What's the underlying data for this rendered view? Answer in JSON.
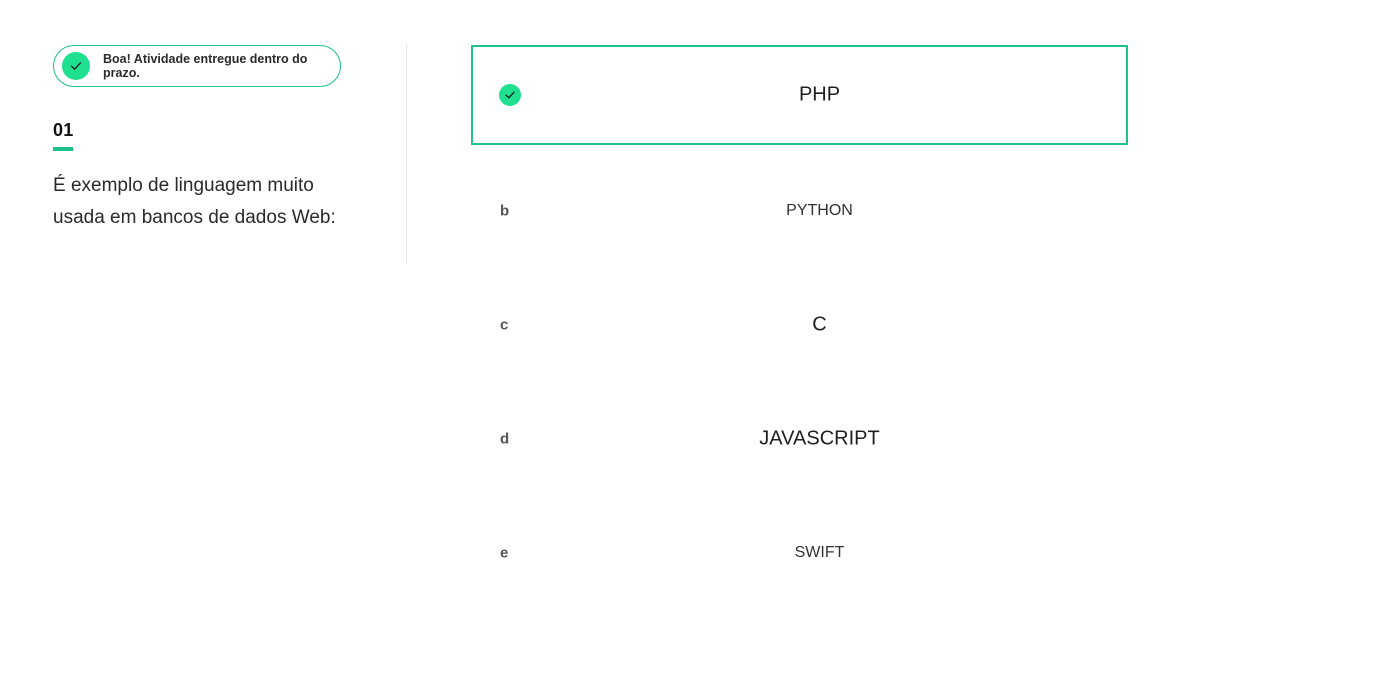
{
  "status_badge": {
    "text": "Boa! Atividade entregue dentro do prazo.",
    "icon": "check-icon",
    "color": "#1ee08f"
  },
  "question": {
    "number": "01",
    "text": "É exemplo de linguagem muito usada em bancos de dados Web:"
  },
  "accent_color": "#1ec28b",
  "options": [
    {
      "letter": "",
      "label": "PHP",
      "selected": true,
      "icon": "check-icon"
    },
    {
      "letter": "b",
      "label": "PYTHON",
      "selected": false
    },
    {
      "letter": "c",
      "label": "C",
      "selected": false
    },
    {
      "letter": "d",
      "label": "JAVASCRIPT",
      "selected": false
    },
    {
      "letter": "e",
      "label": "SWIFT",
      "selected": false
    }
  ]
}
